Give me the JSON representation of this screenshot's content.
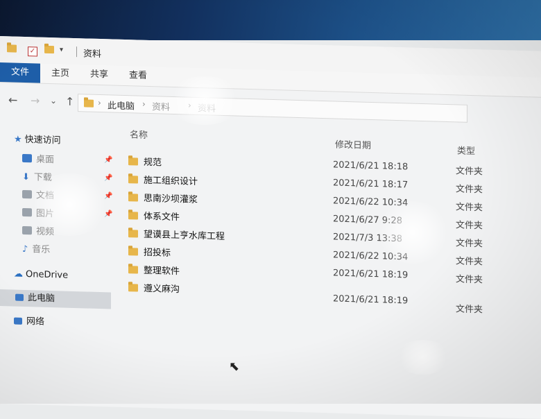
{
  "window": {
    "title": "资料",
    "quick_access_toolbar": [
      "folder-icon",
      "checkbox-icon",
      "folder-icon",
      "dropdown-icon"
    ]
  },
  "ribbon": {
    "tabs": [
      "文件",
      "主页",
      "共享",
      "查看"
    ]
  },
  "nav": {
    "back": "←",
    "forward": "→",
    "dropdown": "⌄",
    "up": "↑",
    "breadcrumb": [
      "此电脑",
      "资料",
      "资料"
    ]
  },
  "sidebar": {
    "quick_access": "快速访问",
    "items": [
      "桌面",
      "下载",
      "文档",
      "图片",
      "视频",
      "音乐"
    ],
    "onedrive": "OneDrive",
    "this_pc": "此电脑",
    "network": "网络"
  },
  "columns": {
    "name": "名称",
    "date": "修改日期",
    "type": "类型"
  },
  "files": [
    {
      "name": "规范",
      "date": "2021/6/21 18:18",
      "type": "文件夹"
    },
    {
      "name": "施工组织设计",
      "date": "2021/6/21 18:17",
      "type": "文件夹"
    },
    {
      "name": "思南沙坝灌浆",
      "date": "2021/6/22 10:34",
      "type": "文件夹"
    },
    {
      "name": "体系文件",
      "date": "2021/6/27 9:28",
      "type": "文件夹"
    },
    {
      "name": "望谟县上亨水库工程",
      "date": "2021/7/3 13:38",
      "type": "文件夹"
    },
    {
      "name": "招投标",
      "date": "2021/6/22 10:34",
      "type": "文件夹"
    },
    {
      "name": "整理软件",
      "date": "2021/6/21 18:19",
      "type": "文件夹"
    },
    {
      "name": "遵义麻沟",
      "date": "2021/6/21 18:19",
      "type": "文件夹"
    }
  ],
  "colors": {
    "file_tab": "#1e5ea8",
    "folder": "#e7b64b",
    "selected_bg": "#d3d6da"
  }
}
